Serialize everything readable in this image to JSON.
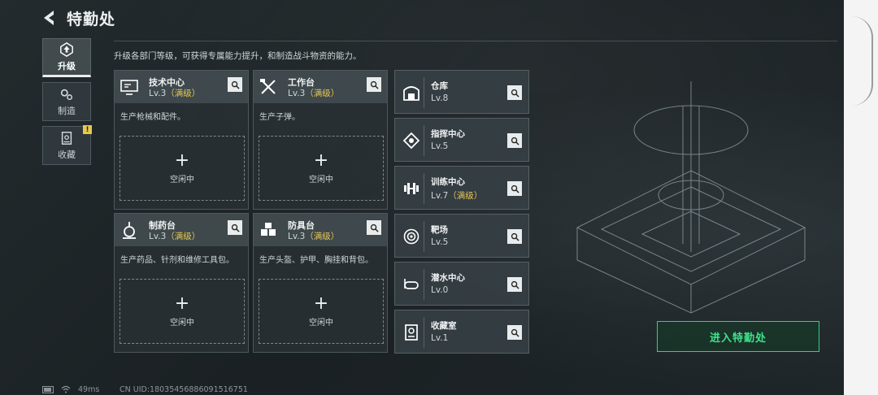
{
  "header": {
    "title": "特勤处",
    "subtitle": "升级各部门等级，可获得专属能力提升，和制造战斗物资的能力。"
  },
  "nav": [
    {
      "label": "升级",
      "icon": "upgrade-icon",
      "active": true
    },
    {
      "label": "制造",
      "icon": "gears-icon",
      "active": false
    },
    {
      "label": "收藏",
      "icon": "collection-icon",
      "active": false,
      "badge": "!"
    }
  ],
  "cards": [
    {
      "name": "技术中心",
      "level": "Lv.3",
      "max": "（满级）",
      "desc": "生产枪械和配件。",
      "slot_label": "空闲中",
      "slot_plus": "+",
      "icon": "tech-center-icon"
    },
    {
      "name": "工作台",
      "level": "Lv.3",
      "max": "（满级）",
      "desc": "生产子弹。",
      "slot_label": "空闲中",
      "slot_plus": "+",
      "icon": "workbench-icon"
    },
    {
      "name": "制药台",
      "level": "Lv.3",
      "max": "（满级）",
      "desc": "生产药品、针剂和维修工具包。",
      "slot_label": "空闲中",
      "slot_plus": "+",
      "icon": "pharmacy-icon"
    },
    {
      "name": "防具台",
      "level": "Lv.3",
      "max": "（满级）",
      "desc": "生产头盔、护甲、胸挂和背包。",
      "slot_label": "空闲中",
      "slot_plus": "+",
      "icon": "armor-bench-icon"
    }
  ],
  "rows": [
    {
      "name": "仓库",
      "level": "Lv.8",
      "max": "",
      "icon": "warehouse-icon"
    },
    {
      "name": "指挥中心",
      "level": "Lv.5",
      "max": "",
      "icon": "command-center-icon"
    },
    {
      "name": "训练中心",
      "level": "Lv.7",
      "max": "（满级）",
      "icon": "dumbbell-icon"
    },
    {
      "name": "靶场",
      "level": "Lv.5",
      "max": "",
      "icon": "target-icon"
    },
    {
      "name": "潜水中心",
      "level": "Lv.0",
      "max": "",
      "icon": "diving-mask-icon"
    },
    {
      "name": "收藏室",
      "level": "Lv.1",
      "max": "",
      "icon": "collection-room-icon"
    }
  ],
  "enter_button": "进入特勤处",
  "status": {
    "ping": "49ms",
    "uid": "CN UID:18035456886091516751"
  },
  "colors": {
    "accent_green": "#3ee48a",
    "max_level_gold": "#e5c553",
    "warning_yellow": "#e7c84a"
  }
}
